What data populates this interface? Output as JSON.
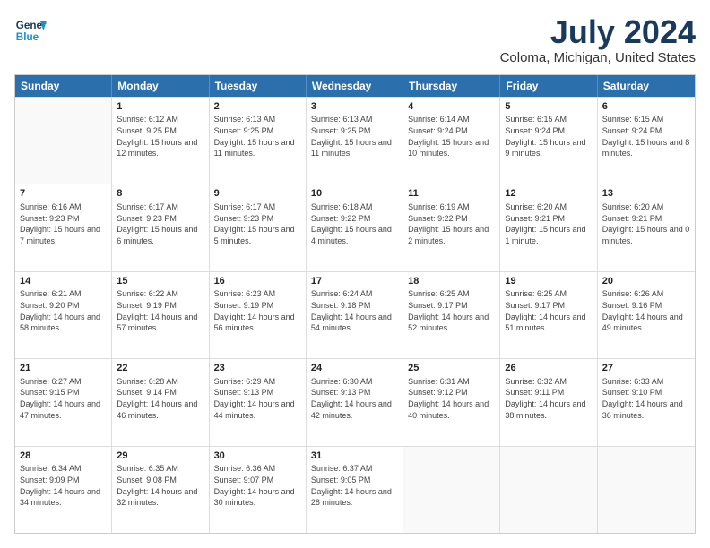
{
  "header": {
    "logo_line1": "General",
    "logo_line2": "Blue",
    "title": "July 2024",
    "subtitle": "Coloma, Michigan, United States"
  },
  "weekdays": [
    "Sunday",
    "Monday",
    "Tuesday",
    "Wednesday",
    "Thursday",
    "Friday",
    "Saturday"
  ],
  "rows": [
    [
      {
        "day": "",
        "empty": true
      },
      {
        "day": "1",
        "sunrise": "6:12 AM",
        "sunset": "9:25 PM",
        "daylight": "15 hours and 12 minutes."
      },
      {
        "day": "2",
        "sunrise": "6:13 AM",
        "sunset": "9:25 PM",
        "daylight": "15 hours and 11 minutes."
      },
      {
        "day": "3",
        "sunrise": "6:13 AM",
        "sunset": "9:25 PM",
        "daylight": "15 hours and 11 minutes."
      },
      {
        "day": "4",
        "sunrise": "6:14 AM",
        "sunset": "9:24 PM",
        "daylight": "15 hours and 10 minutes."
      },
      {
        "day": "5",
        "sunrise": "6:15 AM",
        "sunset": "9:24 PM",
        "daylight": "15 hours and 9 minutes."
      },
      {
        "day": "6",
        "sunrise": "6:15 AM",
        "sunset": "9:24 PM",
        "daylight": "15 hours and 8 minutes."
      }
    ],
    [
      {
        "day": "7",
        "sunrise": "6:16 AM",
        "sunset": "9:23 PM",
        "daylight": "15 hours and 7 minutes."
      },
      {
        "day": "8",
        "sunrise": "6:17 AM",
        "sunset": "9:23 PM",
        "daylight": "15 hours and 6 minutes."
      },
      {
        "day": "9",
        "sunrise": "6:17 AM",
        "sunset": "9:23 PM",
        "daylight": "15 hours and 5 minutes."
      },
      {
        "day": "10",
        "sunrise": "6:18 AM",
        "sunset": "9:22 PM",
        "daylight": "15 hours and 4 minutes."
      },
      {
        "day": "11",
        "sunrise": "6:19 AM",
        "sunset": "9:22 PM",
        "daylight": "15 hours and 2 minutes."
      },
      {
        "day": "12",
        "sunrise": "6:20 AM",
        "sunset": "9:21 PM",
        "daylight": "15 hours and 1 minute."
      },
      {
        "day": "13",
        "sunrise": "6:20 AM",
        "sunset": "9:21 PM",
        "daylight": "15 hours and 0 minutes."
      }
    ],
    [
      {
        "day": "14",
        "sunrise": "6:21 AM",
        "sunset": "9:20 PM",
        "daylight": "14 hours and 58 minutes."
      },
      {
        "day": "15",
        "sunrise": "6:22 AM",
        "sunset": "9:19 PM",
        "daylight": "14 hours and 57 minutes."
      },
      {
        "day": "16",
        "sunrise": "6:23 AM",
        "sunset": "9:19 PM",
        "daylight": "14 hours and 56 minutes."
      },
      {
        "day": "17",
        "sunrise": "6:24 AM",
        "sunset": "9:18 PM",
        "daylight": "14 hours and 54 minutes."
      },
      {
        "day": "18",
        "sunrise": "6:25 AM",
        "sunset": "9:17 PM",
        "daylight": "14 hours and 52 minutes."
      },
      {
        "day": "19",
        "sunrise": "6:25 AM",
        "sunset": "9:17 PM",
        "daylight": "14 hours and 51 minutes."
      },
      {
        "day": "20",
        "sunrise": "6:26 AM",
        "sunset": "9:16 PM",
        "daylight": "14 hours and 49 minutes."
      }
    ],
    [
      {
        "day": "21",
        "sunrise": "6:27 AM",
        "sunset": "9:15 PM",
        "daylight": "14 hours and 47 minutes."
      },
      {
        "day": "22",
        "sunrise": "6:28 AM",
        "sunset": "9:14 PM",
        "daylight": "14 hours and 46 minutes."
      },
      {
        "day": "23",
        "sunrise": "6:29 AM",
        "sunset": "9:13 PM",
        "daylight": "14 hours and 44 minutes."
      },
      {
        "day": "24",
        "sunrise": "6:30 AM",
        "sunset": "9:13 PM",
        "daylight": "14 hours and 42 minutes."
      },
      {
        "day": "25",
        "sunrise": "6:31 AM",
        "sunset": "9:12 PM",
        "daylight": "14 hours and 40 minutes."
      },
      {
        "day": "26",
        "sunrise": "6:32 AM",
        "sunset": "9:11 PM",
        "daylight": "14 hours and 38 minutes."
      },
      {
        "day": "27",
        "sunrise": "6:33 AM",
        "sunset": "9:10 PM",
        "daylight": "14 hours and 36 minutes."
      }
    ],
    [
      {
        "day": "28",
        "sunrise": "6:34 AM",
        "sunset": "9:09 PM",
        "daylight": "14 hours and 34 minutes."
      },
      {
        "day": "29",
        "sunrise": "6:35 AM",
        "sunset": "9:08 PM",
        "daylight": "14 hours and 32 minutes."
      },
      {
        "day": "30",
        "sunrise": "6:36 AM",
        "sunset": "9:07 PM",
        "daylight": "14 hours and 30 minutes."
      },
      {
        "day": "31",
        "sunrise": "6:37 AM",
        "sunset": "9:05 PM",
        "daylight": "14 hours and 28 minutes."
      },
      {
        "day": "",
        "empty": true
      },
      {
        "day": "",
        "empty": true
      },
      {
        "day": "",
        "empty": true
      }
    ]
  ]
}
